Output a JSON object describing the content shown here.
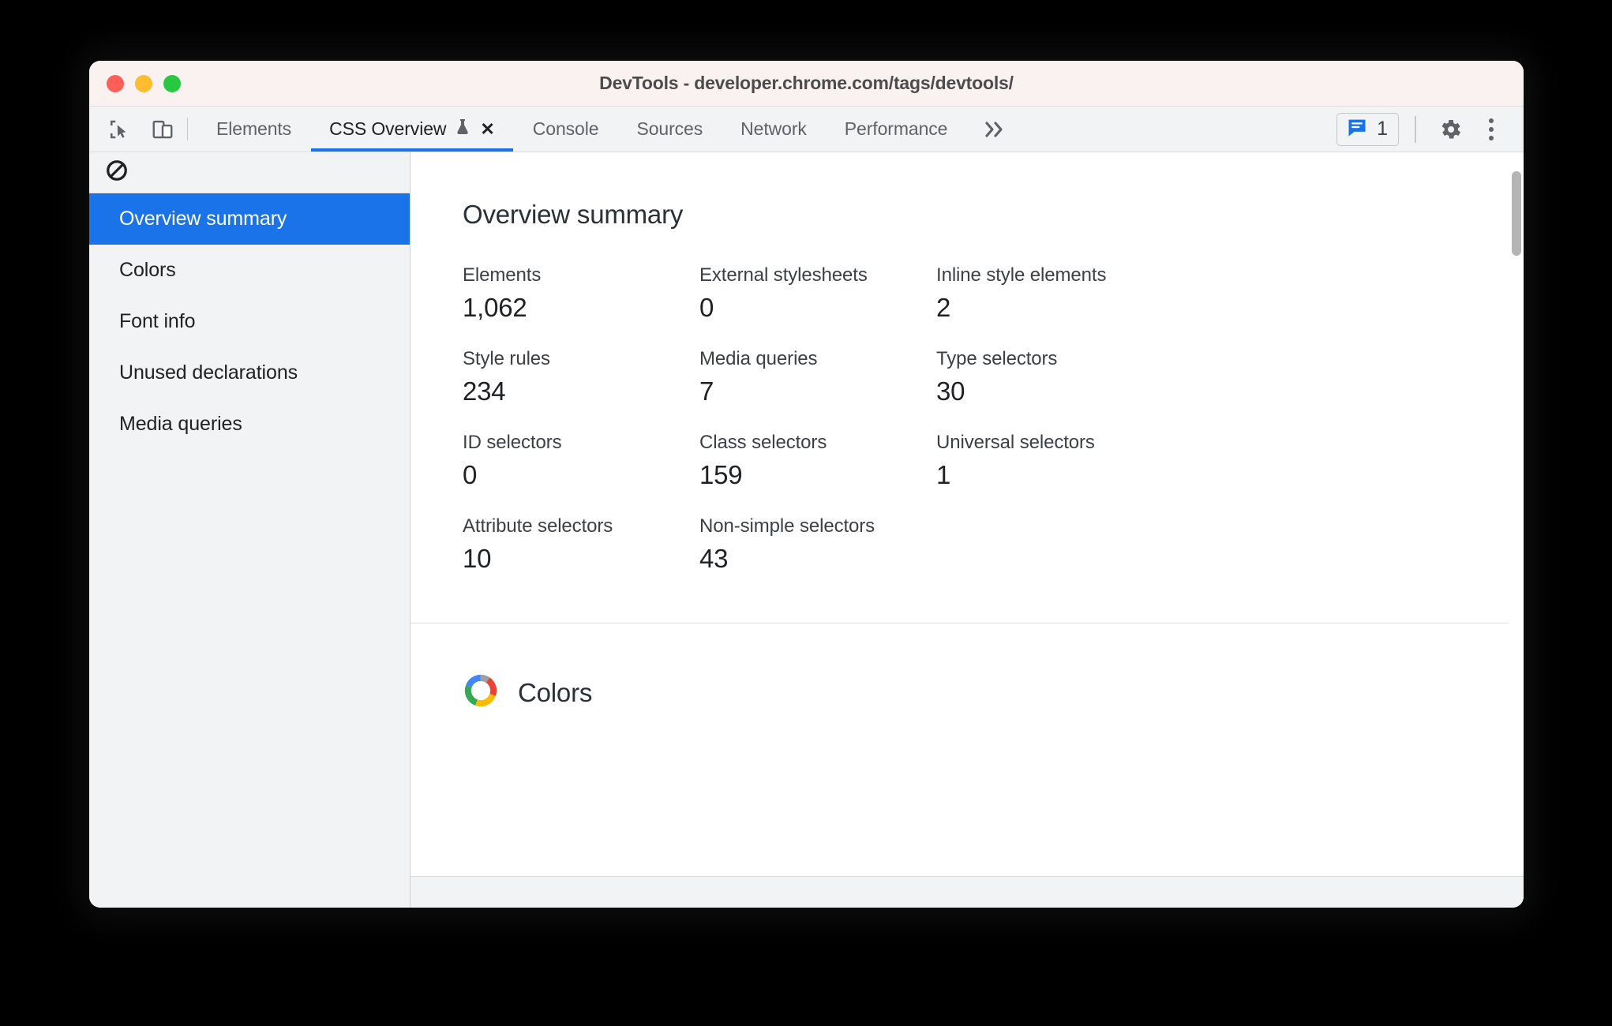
{
  "window": {
    "title": "DevTools - developer.chrome.com/tags/devtools/",
    "traffic_lights": [
      {
        "name": "close",
        "color": "#ff5f57"
      },
      {
        "name": "minimize",
        "color": "#febc2e"
      },
      {
        "name": "zoom",
        "color": "#28c840"
      }
    ]
  },
  "toolbar": {
    "left_icons": [
      {
        "name": "inspect-element-icon",
        "label": "Inspect element"
      },
      {
        "name": "device-toolbar-icon",
        "label": "Toggle device toolbar"
      }
    ],
    "tabs": [
      {
        "label": "Elements",
        "active": false,
        "experimental": false,
        "closable": false
      },
      {
        "label": "CSS Overview",
        "active": true,
        "experimental": true,
        "closable": true
      },
      {
        "label": "Console",
        "active": false,
        "experimental": false,
        "closable": false
      },
      {
        "label": "Sources",
        "active": false,
        "experimental": false,
        "closable": false
      },
      {
        "label": "Network",
        "active": false,
        "experimental": false,
        "closable": false
      },
      {
        "label": "Performance",
        "active": false,
        "experimental": false,
        "closable": false
      }
    ],
    "overflow_label": "»",
    "close_label": "✕",
    "issues": {
      "count": "1",
      "icon": "issues-message-icon",
      "color": "#1a73e8"
    },
    "settings_icon": "gear-icon",
    "more_icon": "three-dots-vertical-icon",
    "active_tab_color": "#1a73e8"
  },
  "sidebar": {
    "clear_icon": "block-clear-icon",
    "items": [
      {
        "label": "Overview summary",
        "selected": true
      },
      {
        "label": "Colors",
        "selected": false
      },
      {
        "label": "Font info",
        "selected": false
      },
      {
        "label": "Unused declarations",
        "selected": false
      },
      {
        "label": "Media queries",
        "selected": false
      }
    ],
    "selected_bg": "#1a73e8"
  },
  "main": {
    "title": "Overview summary",
    "stats": [
      {
        "label": "Elements",
        "value": "1,062"
      },
      {
        "label": "External stylesheets",
        "value": "0"
      },
      {
        "label": "Inline style elements",
        "value": "2"
      },
      {
        "label": "Style rules",
        "value": "234"
      },
      {
        "label": "Media queries",
        "value": "7"
      },
      {
        "label": "Type selectors",
        "value": "30"
      },
      {
        "label": "ID selectors",
        "value": "0"
      },
      {
        "label": "Class selectors",
        "value": "159"
      },
      {
        "label": "Universal selectors",
        "value": "1"
      },
      {
        "label": "Attribute selectors",
        "value": "10"
      },
      {
        "label": "Non-simple selectors",
        "value": "43"
      }
    ],
    "colors_section": {
      "title": "Colors",
      "icon": "color-wheel-icon",
      "wheel_colors": [
        "#4285f4",
        "#9aa0a6",
        "#ea4335",
        "#fbbc04",
        "#34a853"
      ]
    }
  }
}
